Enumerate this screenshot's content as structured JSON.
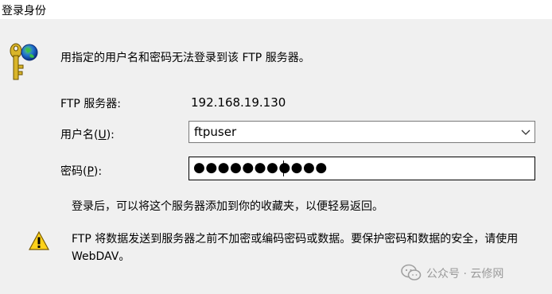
{
  "window": {
    "title": "登录身份"
  },
  "message": "用指定的用户名和密码无法登录到该 FTP 服务器。",
  "server": {
    "label": "FTP 服务器:",
    "value": "192.168.19.130"
  },
  "username": {
    "label_pre": "用户名(",
    "accel": "U",
    "label_post": "):",
    "value": "ftpuser"
  },
  "password": {
    "label_pre": "密码(",
    "accel": "P",
    "label_post": "):",
    "value": "●●●●●●●●●●●"
  },
  "info_text": "登录后，可以将这个服务器添加到你的收藏夹，以便轻易返回。",
  "warning": {
    "line1": "FTP 将数据发送到服务器之前不加密或编码密码或数据。要保护密码和数据的安全，请使用",
    "line2": "WebDAV。"
  },
  "watermark": {
    "text": "公众号 · 云修网"
  },
  "icons": {
    "key": "key-globe-icon",
    "warning": "warning-icon",
    "dropdown": "chevron-down-icon"
  }
}
